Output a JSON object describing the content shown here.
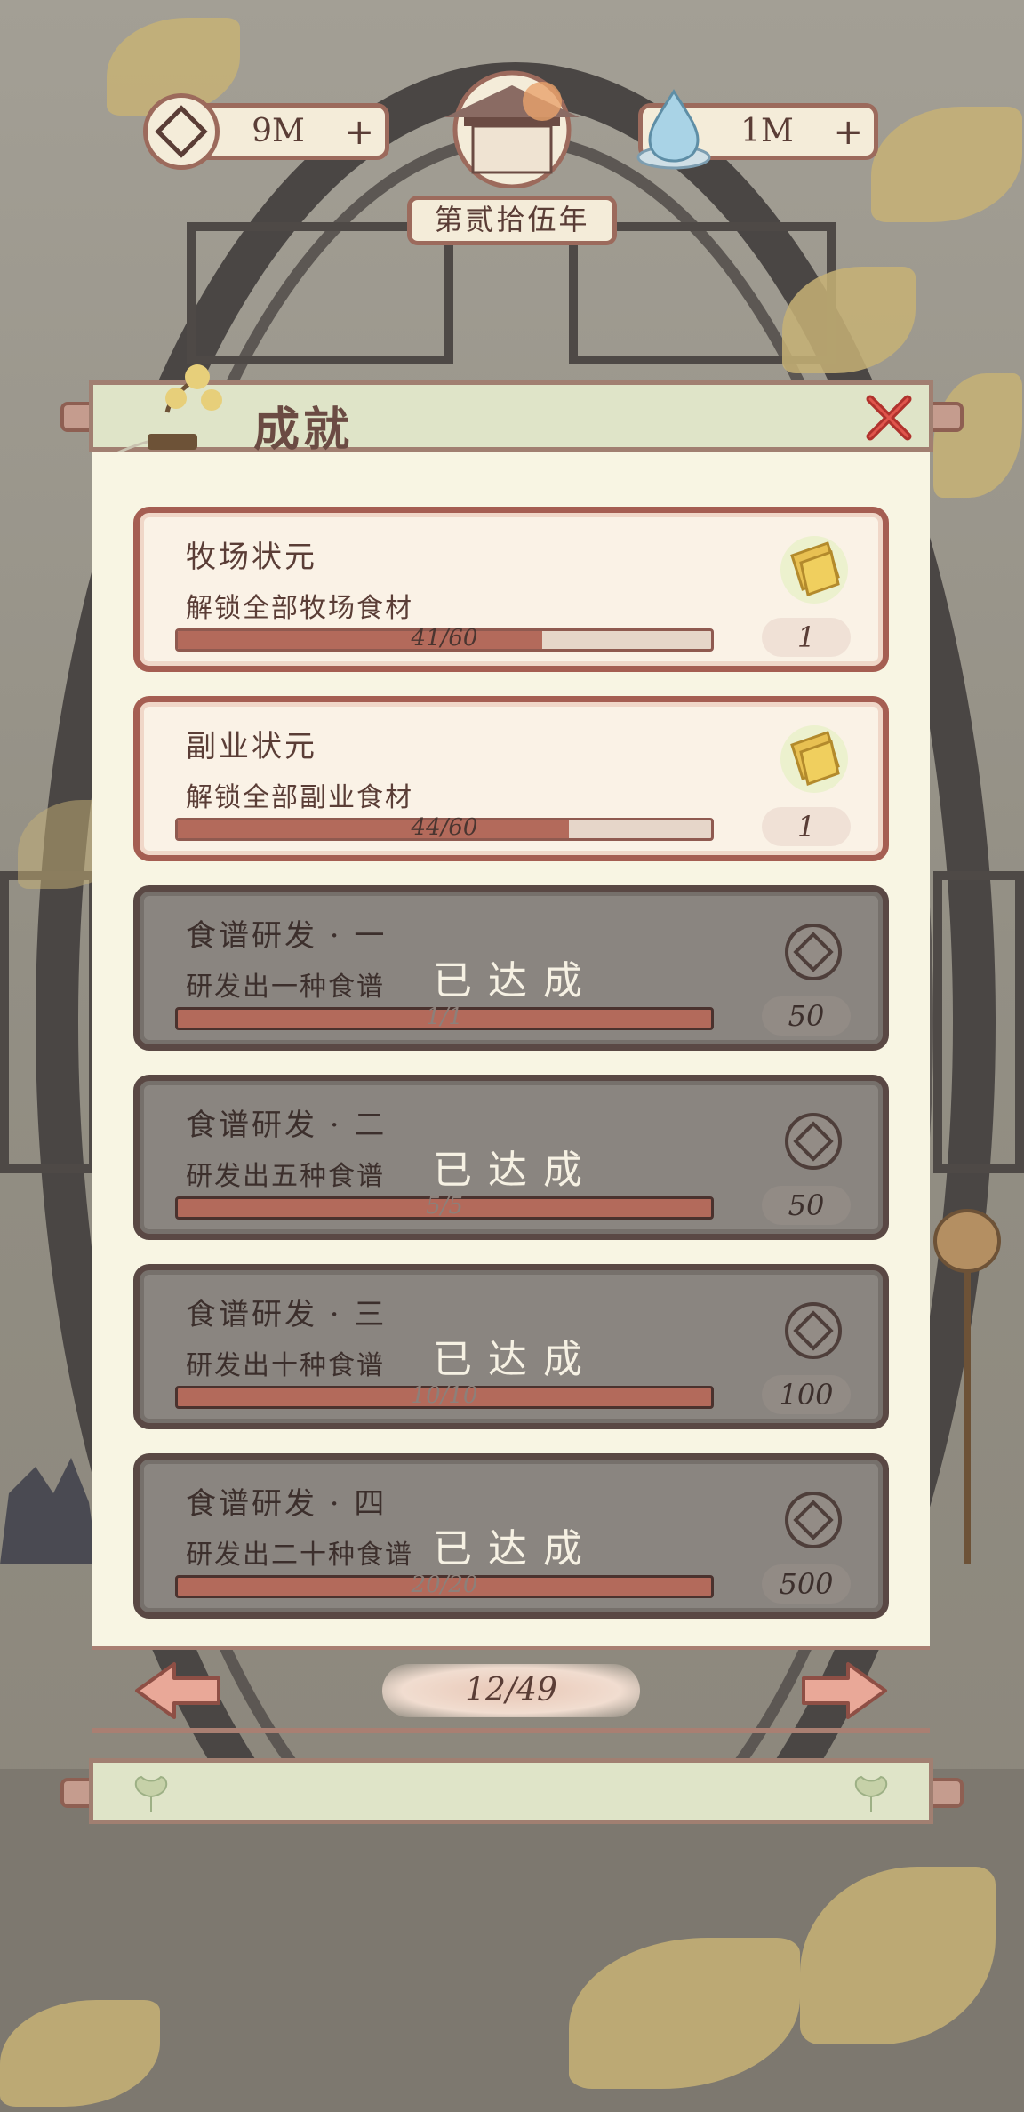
{
  "resources": {
    "coins": "9M",
    "water": "1M"
  },
  "year_label": "第贰拾伍年",
  "panel": {
    "title": "成就",
    "page": "12/49"
  },
  "achievements": [
    {
      "name": "牧场状元",
      "desc": "解锁全部牧场食材",
      "progress_text": "41/60",
      "progress": 0.683,
      "reward_icon": "ticket-icon",
      "reward": "1",
      "completed": false
    },
    {
      "name": "副业状元",
      "desc": "解锁全部副业食材",
      "progress_text": "44/60",
      "progress": 0.733,
      "reward_icon": "ticket-icon",
      "reward": "1",
      "completed": false
    },
    {
      "name": "食谱研发 · 一",
      "desc": "研发出一种食谱",
      "progress_text": "1/1",
      "progress": 1,
      "reward_icon": "coin-icon",
      "reward": "50",
      "completed": true,
      "status": "已达成"
    },
    {
      "name": "食谱研发 · 二",
      "desc": "研发出五种食谱",
      "progress_text": "5/5",
      "progress": 1,
      "reward_icon": "coin-icon",
      "reward": "50",
      "completed": true,
      "status": "已达成"
    },
    {
      "name": "食谱研发 · 三",
      "desc": "研发出十种食谱",
      "progress_text": "10/10",
      "progress": 1,
      "reward_icon": "coin-icon",
      "reward": "100",
      "completed": true,
      "status": "已达成"
    },
    {
      "name": "食谱研发 · 四",
      "desc": "研发出二十种食谱",
      "progress_text": "20/20",
      "progress": 1,
      "reward_icon": "coin-icon",
      "reward": "500",
      "completed": true,
      "status": "已达成"
    }
  ],
  "colors": {
    "panel_bg": "#f8f5e3",
    "header_bg": "#dfe4c8",
    "card_border": "#a55e52",
    "progress_fill": "#b36a5b",
    "completed_overlay": "#8a8580",
    "text": "#5a3d36"
  }
}
